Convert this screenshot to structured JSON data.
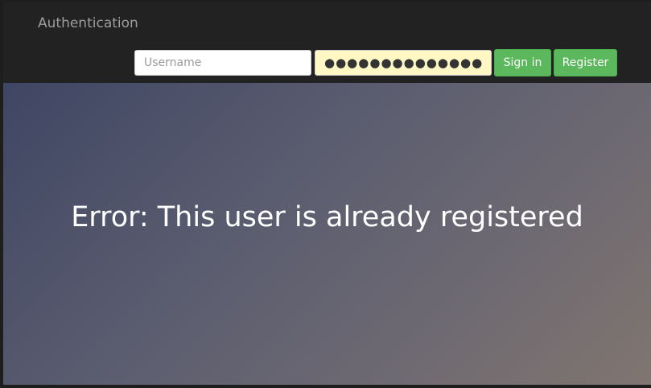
{
  "navbar": {
    "brand": "Authentication",
    "username": {
      "value": "",
      "placeholder": "Username"
    },
    "password": {
      "value": "●●●●●●●●●●●●●●●●"
    },
    "signin_label": "Sign in",
    "register_label": "Register"
  },
  "hero": {
    "message": "Error: This user is already registered"
  },
  "colors": {
    "navbar_bg": "#222222",
    "button_green": "#5cb85c",
    "autofill_yellow": "#fff8c5"
  }
}
